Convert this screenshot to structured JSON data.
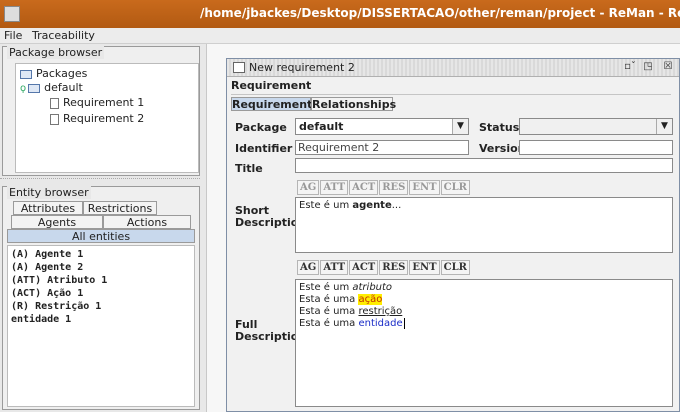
{
  "window": {
    "title": "/home/jbackes/Desktop/DISSERTACAO/other/reman/project - ReMan - Requirements"
  },
  "menu": {
    "file": "File",
    "traceability": "Traceability"
  },
  "package_browser": {
    "title": "Package browser",
    "tree": [
      {
        "label": "Packages"
      },
      {
        "label": "default"
      },
      {
        "label": "Requirement 1"
      },
      {
        "label": "Requirement 2"
      }
    ]
  },
  "entity_browser": {
    "title": "Entity browser",
    "tabs_row1": [
      "Attributes",
      "Restrictions"
    ],
    "tabs_row2": [
      "Agents",
      "Actions"
    ],
    "tab_active": "All entities",
    "items": [
      "(A) Agente 1",
      "(A) Agente 2",
      "(ATT) Atributo 1",
      "(ACT) Ação 1",
      "(R) Restrição 1",
      "entidade 1"
    ]
  },
  "editor": {
    "title": "New requirement 2",
    "section": "Requirement",
    "tabs": [
      "Requirement",
      "Relationships"
    ],
    "labels": {
      "package": "Package",
      "status": "Status",
      "identifier": "Identifier",
      "version": "Version",
      "title": "Title",
      "short_description": [
        "Short",
        "Description"
      ],
      "full_description": [
        "Full",
        "Description"
      ]
    },
    "values": {
      "package": "default",
      "status": "",
      "identifier": "Requirement 2",
      "version": "",
      "title": ""
    },
    "toolbar_buttons": [
      "AG",
      "ATT",
      "ACT",
      "RES",
      "ENT",
      "CLR"
    ],
    "short_description": {
      "prefix": "Este é um ",
      "bold": "agente",
      "suffix": "..."
    },
    "full_description": {
      "l1_prefix": "Este é um ",
      "l1_word": "atributo",
      "l2_prefix": "Esta é uma ",
      "l2_word": "ação",
      "l3_prefix": "Esta é uma ",
      "l3_word": "restrição",
      "l4_prefix": "Esta é uma ",
      "l4_word": "entidade"
    }
  },
  "icons": {
    "app": "app-icon",
    "folder": "folder-icon",
    "document": "document-icon"
  }
}
